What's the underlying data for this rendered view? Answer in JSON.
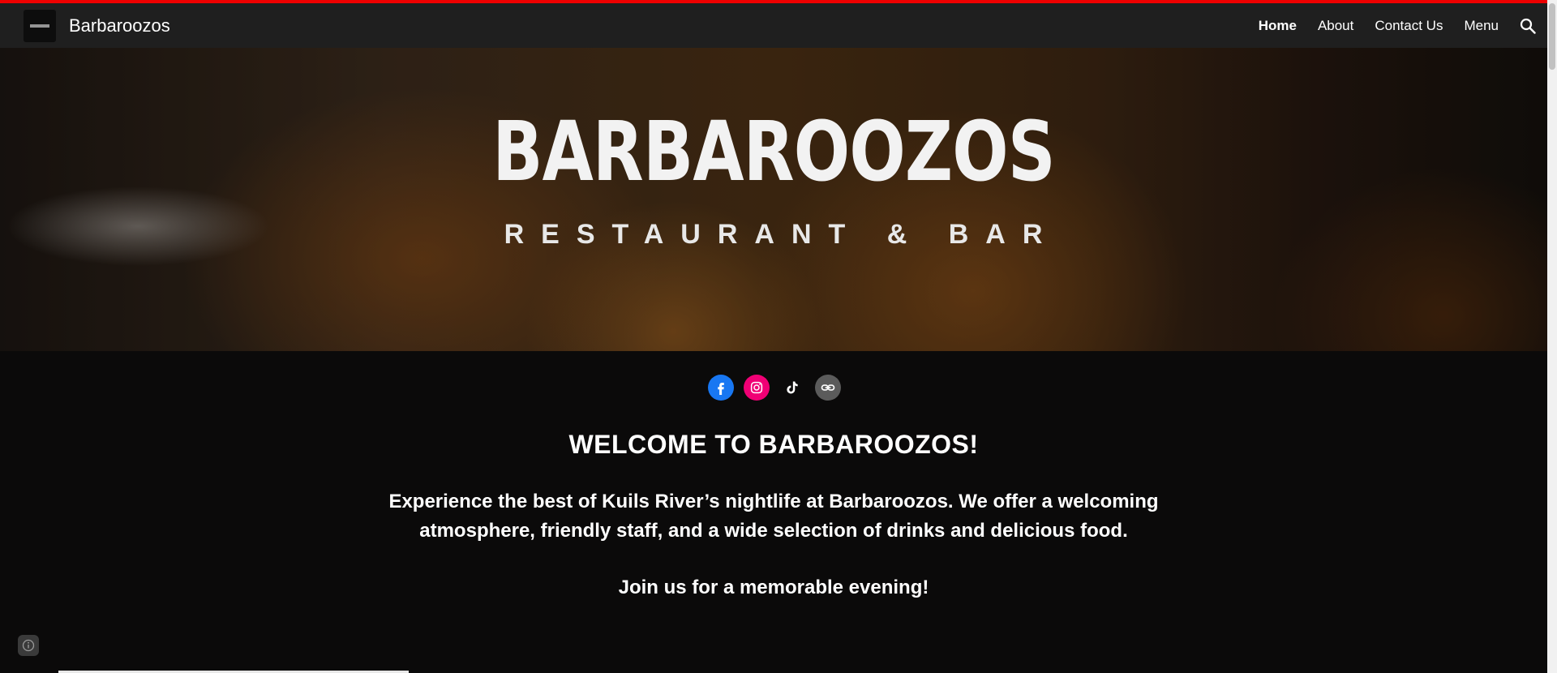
{
  "header": {
    "site_title": "Barbaroozos",
    "nav": [
      {
        "label": "Home",
        "active": true
      },
      {
        "label": "About",
        "active": false
      },
      {
        "label": "Contact Us",
        "active": false
      },
      {
        "label": "Menu",
        "active": false
      }
    ],
    "search_icon": "search-icon"
  },
  "hero": {
    "title": "BARBAROOZOS",
    "subtitle": "RESTAURANT & BAR"
  },
  "social": [
    {
      "icon": "facebook-icon",
      "color": "#1877f2"
    },
    {
      "icon": "instagram-icon",
      "color": "#f00075"
    },
    {
      "icon": "tiktok-icon",
      "color": "#ffffff"
    },
    {
      "icon": "link-icon",
      "color": "#5b5b5b"
    }
  ],
  "main": {
    "heading": "WELCOME TO BARBAROOZOS!",
    "paragraph": "Experience the best of Kuils River’s nightlife at Barbaroozos. We offer a welcoming atmosphere, friendly staff, and a wide selection of drinks and delicious food.",
    "paragraph2": "Join us for a memorable evening!"
  },
  "colors": {
    "accent_line": "#e00000",
    "navbar": "#1f1f1f",
    "page_bg": "#0b0a0a"
  }
}
